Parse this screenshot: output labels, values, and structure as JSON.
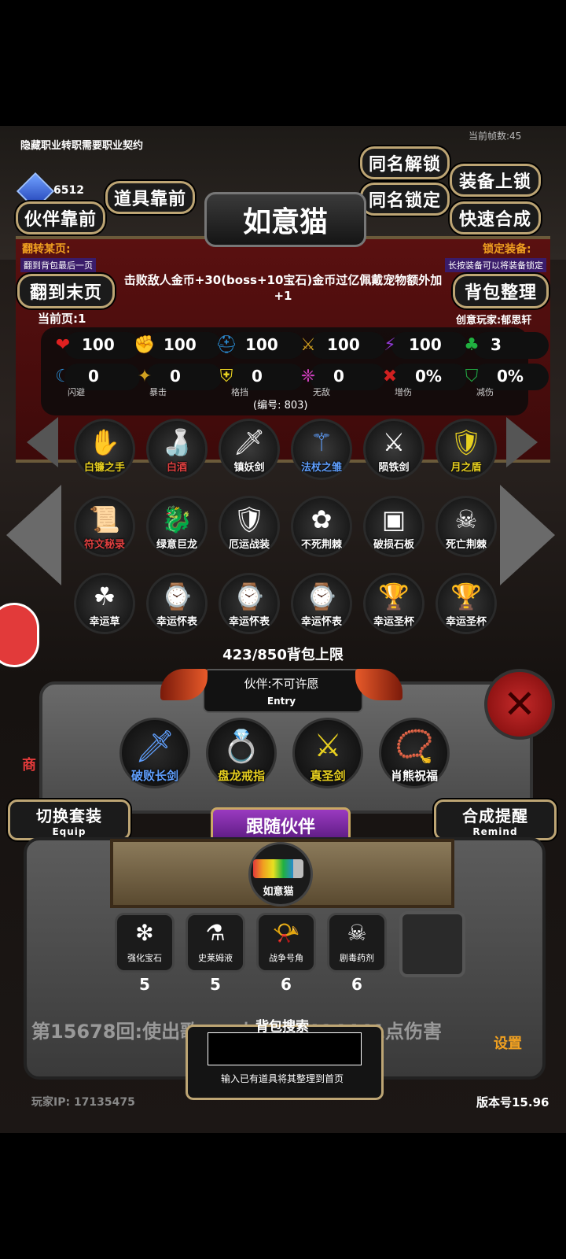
{
  "top_notice": "隐藏职业转职需要职业契约",
  "fps": "当前帧数:45",
  "gem_count": "6512",
  "buttons": {
    "same_name_unlock": "同名解锁",
    "equip_lock": "装备上锁",
    "item_front": "道具靠前",
    "same_name_lock": "同名锁定",
    "partner_front": "伙伴靠前",
    "quick_synthesis": "快速合成",
    "go_last_page": "翻到末页",
    "bag_sort": "背包整理",
    "switch_set": "切换套装",
    "switch_set_sub": "Equip",
    "synthesis_remind": "合成提醒",
    "synthesis_remind_sub": "Remind",
    "follow_partner": "跟随伙伴",
    "settings": "设置"
  },
  "character_name": "如意猫",
  "flip_page": {
    "title": "翻转某页:",
    "desc": "翻到背包最后一页"
  },
  "lock_equip": {
    "title": "锁定装备:",
    "desc": "长按装备可以将装备锁定"
  },
  "bonus_text": "击败敌人金币+30(boss+10宝石)金币过亿佩戴宠物额外加+1",
  "current_page": "当前页:1",
  "creator": "创意玩家:郁思轩",
  "stats_row1": [
    {
      "icon": "heart-icon",
      "value": "100",
      "color": "#e02020",
      "glyph": "❤"
    },
    {
      "icon": "strength-icon",
      "value": "100",
      "color": "#e8c020",
      "glyph": "✊"
    },
    {
      "icon": "helmet-icon",
      "value": "100",
      "color": "#2a8ad0",
      "glyph": "⛑"
    },
    {
      "icon": "sword-icon",
      "value": "100",
      "color": "#d0a020",
      "glyph": "⚔"
    },
    {
      "icon": "lightning-icon",
      "value": "100",
      "color": "#8a3ad0",
      "glyph": "⚡"
    },
    {
      "icon": "clover-icon",
      "value": "3",
      "color": "#20b040",
      "glyph": "♣"
    }
  ],
  "stats_row2": [
    {
      "icon": "dodge-icon",
      "value": "0",
      "label": "闪避",
      "color": "#2a8ad0",
      "glyph": "☾"
    },
    {
      "icon": "crit-icon",
      "value": "0",
      "label": "暴击",
      "color": "#d0a020",
      "glyph": "✦"
    },
    {
      "icon": "block-icon",
      "value": "0",
      "label": "格挡",
      "color": "#e8d020",
      "glyph": "⛨"
    },
    {
      "icon": "invincible-icon",
      "value": "0",
      "label": "无敌",
      "color": "#d040c0",
      "glyph": "❈"
    },
    {
      "icon": "damage-up-icon",
      "value": "0%",
      "label": "增伤",
      "color": "#d02020",
      "glyph": "✖"
    },
    {
      "icon": "damage-down-icon",
      "value": "0%",
      "label": "减伤",
      "color": "#20a040",
      "glyph": "⛉"
    }
  ],
  "serial": "(编号: 803)",
  "inventory": [
    {
      "name": "白镰之手",
      "glyph": "✋",
      "color": "#e8d020"
    },
    {
      "name": "白酒",
      "glyph": "🍶",
      "color": "#e04040"
    },
    {
      "name": "镇妖剑",
      "glyph": "🗡",
      "color": "#ffffff"
    },
    {
      "name": "法杖之雏",
      "glyph": "⚚",
      "color": "#60a0ff"
    },
    {
      "name": "陨铁剑",
      "glyph": "⚔",
      "color": "#ffffff"
    },
    {
      "name": "月之盾",
      "glyph": "🛡",
      "color": "#e8d020"
    },
    {
      "name": "符文秘录",
      "glyph": "📜",
      "color": "#e04040"
    },
    {
      "name": "绿意巨龙",
      "glyph": "🐉",
      "color": "#ffffff"
    },
    {
      "name": "厄运战装",
      "glyph": "🛡",
      "color": "#ffffff"
    },
    {
      "name": "不死荆棘",
      "glyph": "✿",
      "color": "#ffffff"
    },
    {
      "name": "破损石板",
      "glyph": "▣",
      "color": "#ffffff"
    },
    {
      "name": "死亡荆棘",
      "glyph": "☠",
      "color": "#ffffff"
    },
    {
      "name": "幸运草",
      "glyph": "☘",
      "color": "#ffffff"
    },
    {
      "name": "幸运怀表",
      "glyph": "⌚",
      "color": "#ffffff"
    },
    {
      "name": "幸运怀表",
      "glyph": "⌚",
      "color": "#ffffff"
    },
    {
      "name": "幸运怀表",
      "glyph": "⌚",
      "color": "#ffffff"
    },
    {
      "name": "幸运圣杯",
      "glyph": "🏆",
      "color": "#ffffff"
    },
    {
      "name": "幸运圣杯",
      "glyph": "🏆",
      "color": "#ffffff"
    }
  ],
  "bag_capacity": "423/850背包上限",
  "entry_title": "伙伴:不可许愿",
  "entry_sub": "Entry",
  "equipped": [
    {
      "name": "破败长剑",
      "glyph": "🗡",
      "color": "#60a0ff"
    },
    {
      "name": "盘龙戒指",
      "glyph": "💍",
      "color": "#e8d020"
    },
    {
      "name": "真圣剑",
      "glyph": "⚔",
      "color": "#e8d020"
    },
    {
      "name": "肖熊祝福",
      "glyph": "📿",
      "color": "#ffffff"
    }
  ],
  "partner_name": "如意猫",
  "consumables": [
    {
      "name": "强化宝石",
      "count": "5",
      "glyph": "❇"
    },
    {
      "name": "史莱姆液",
      "count": "5",
      "glyph": "⚗"
    },
    {
      "name": "战争号角",
      "count": "6",
      "glyph": "📯"
    },
    {
      "name": "剧毒药剂",
      "count": "6",
      "glyph": "☠"
    }
  ],
  "battle_log": "第15678回:使出歌……人造成2414441点伤害",
  "search": {
    "title": "背包搜索",
    "hint": "输入已有道具将其整理到首页",
    "placeholder": ""
  },
  "player_ip": "玩家IP: 17135475",
  "version": "版本号15.96",
  "side_shop": "商"
}
